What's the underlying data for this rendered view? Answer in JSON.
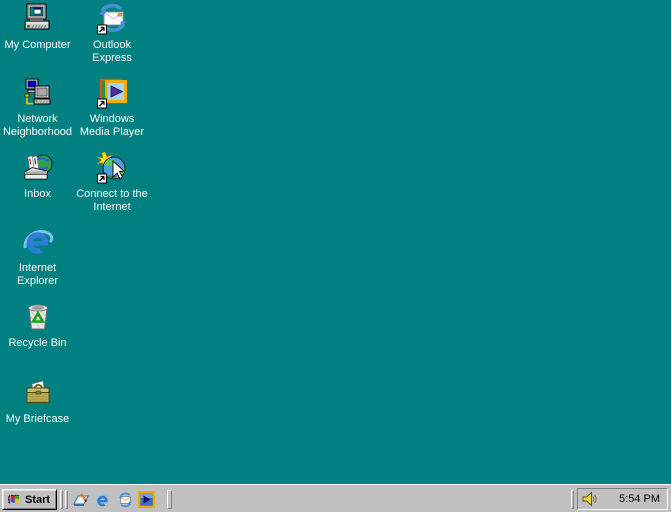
{
  "colors": {
    "desktop_background": "#008080",
    "taskbar_background": "#c0c0c0",
    "icon_label_text": "#ffffff"
  },
  "desktop": {
    "icons": [
      {
        "name": "my-computer",
        "icon": "my-computer-icon",
        "lines": [
          "My Computer"
        ],
        "shortcut": false
      },
      {
        "name": "outlook-express",
        "icon": "outlook-express-icon",
        "lines": [
          "Outlook",
          "Express"
        ],
        "shortcut": true
      },
      {
        "name": "network-neighborhood",
        "icon": "network-neighborhood-icon",
        "lines": [
          "Network",
          "Neighborhood"
        ],
        "shortcut": false
      },
      {
        "name": "windows-media-player",
        "icon": "media-player-icon",
        "lines": [
          "Windows",
          "Media Player"
        ],
        "shortcut": true
      },
      {
        "name": "inbox",
        "icon": "inbox-icon",
        "lines": [
          "Inbox"
        ],
        "shortcut": false
      },
      {
        "name": "connect-to-the-internet",
        "icon": "connect-internet-icon",
        "lines": [
          "Connect to the",
          "Internet"
        ],
        "shortcut": true
      },
      {
        "name": "internet-explorer",
        "icon": "internet-explorer-icon",
        "lines": [
          "Internet",
          "Explorer"
        ],
        "shortcut": false
      },
      {
        "name": "recycle-bin",
        "icon": "recycle-bin-icon",
        "lines": [
          "Recycle Bin"
        ],
        "shortcut": false
      },
      {
        "name": "my-briefcase",
        "icon": "briefcase-icon",
        "lines": [
          "My Briefcase"
        ],
        "shortcut": false
      }
    ]
  },
  "taskbar": {
    "start": {
      "label": "Start",
      "icon": "windows-flag-icon"
    },
    "quick_launch": [
      {
        "icon": "show-desktop-icon"
      },
      {
        "icon": "internet-explorer-icon"
      },
      {
        "icon": "outlook-express-icon"
      },
      {
        "icon": "media-player-icon"
      }
    ],
    "tray": {
      "icons": [
        {
          "icon": "volume-icon"
        }
      ],
      "clock": "5:54 PM"
    }
  }
}
